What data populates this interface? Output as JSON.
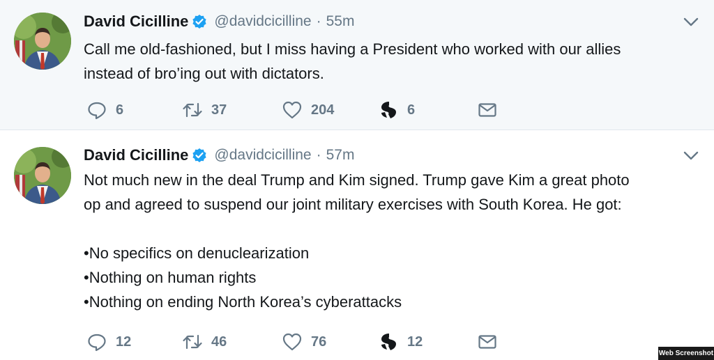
{
  "tweets": [
    {
      "name": "David Cicilline",
      "handle": "@davidcicilline",
      "separator": "·",
      "time": "55m",
      "lines": [
        "Call me old-fashioned, but I miss having a President who worked with our allies",
        "instead of bro’ing out with dictators."
      ],
      "replies": "6",
      "retweets": "37",
      "likes": "204",
      "shares": "6"
    },
    {
      "name": "David Cicilline",
      "handle": "@davidcicilline",
      "separator": "·",
      "time": "57m",
      "lines": [
        "Not much new in the deal Trump and Kim signed. Trump gave Kim a great photo",
        "op and agreed to suspend our joint military exercises with South Korea. He got:",
        "",
        "•No specifics on denuclearization",
        "•Nothing on human rights",
        "•Nothing on ending North Korea’s cyberattacks"
      ],
      "replies": "12",
      "retweets": "46",
      "likes": "76",
      "shares": "12"
    }
  ],
  "icons": {
    "verified": "verified-badge-icon",
    "caret": "chevron-down-icon",
    "reply": "reply-icon",
    "retweet": "retweet-icon",
    "like": "heart-icon",
    "share": "s-share-icon",
    "dm": "direct-message-icon"
  },
  "colors": {
    "verified": "#1da1f2",
    "muted": "#657786",
    "text": "#14171a",
    "first_tweet_bg": "#f5f8fa"
  },
  "watermark": "Web Screenshot"
}
